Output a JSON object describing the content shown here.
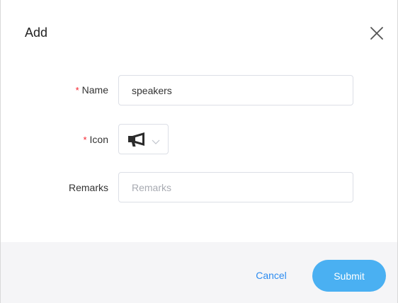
{
  "dialog": {
    "title": "Add",
    "close_icon": "close-icon"
  },
  "form": {
    "name": {
      "required_mark": "*",
      "label": "Name",
      "value": "speakers"
    },
    "icon": {
      "required_mark": "*",
      "label": "Icon",
      "selected_icon": "megaphone-icon",
      "dropdown_icon": "chevron-down-icon"
    },
    "remarks": {
      "label": "Remarks",
      "value": "",
      "placeholder": "Remarks"
    }
  },
  "footer": {
    "cancel_label": "Cancel",
    "submit_label": "Submit"
  },
  "colors": {
    "accent": "#4ab0f2",
    "link": "#2d8cf0",
    "required": "#f5222d",
    "footer_bg": "#f5f5f7"
  }
}
